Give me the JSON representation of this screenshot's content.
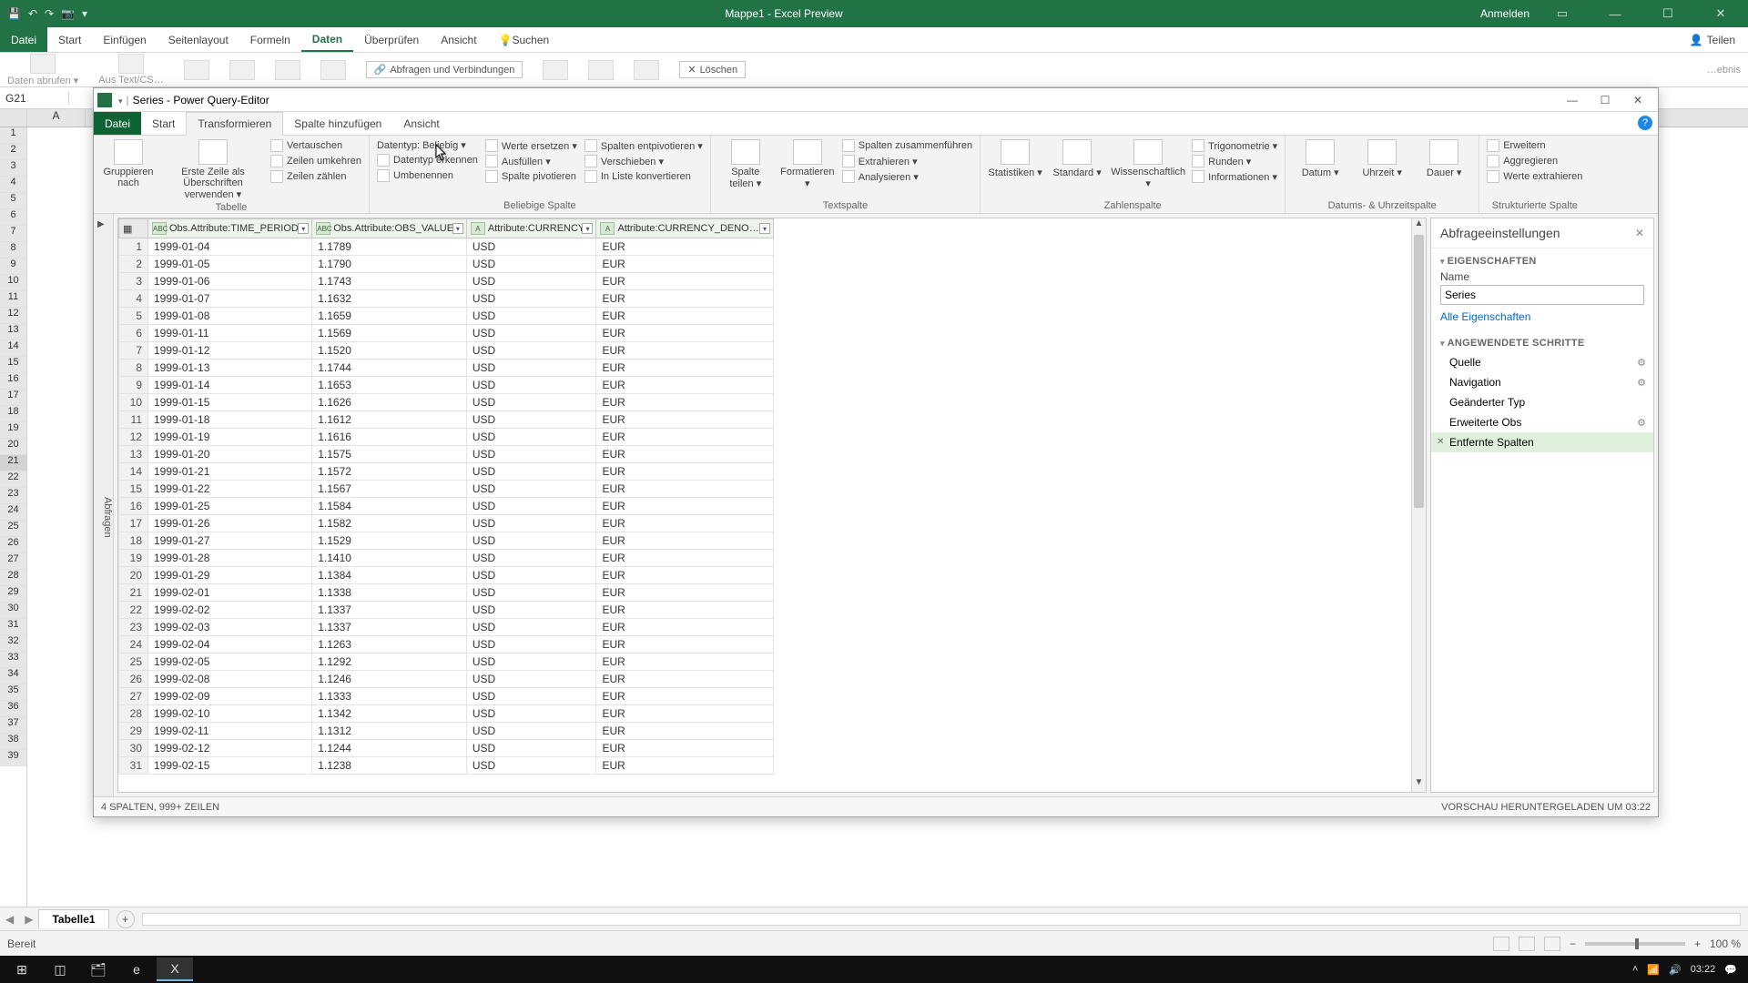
{
  "app": {
    "title": "Mappe1  -  Excel Preview",
    "signin": "Anmelden"
  },
  "excel_tabs": {
    "file": "Datei",
    "start": "Start",
    "insert": "Einfügen",
    "layout": "Seitenlayout",
    "formulas": "Formeln",
    "data": "Daten",
    "review": "Überprüfen",
    "view": "Ansicht",
    "search_ph": "Suchen",
    "share": "Teilen"
  },
  "excel_ribbon": {
    "get": "Daten abrufen ▾",
    "fromtxt": "Aus Text/CS…",
    "conns": "Abfragen und Verbindungen",
    "del": "Löschen",
    "result": "…ebnis"
  },
  "namebox": "G21",
  "col_headers": [
    "A"
  ],
  "row_numbers": [
    1,
    2,
    3,
    4,
    5,
    6,
    7,
    8,
    9,
    10,
    11,
    12,
    13,
    14,
    15,
    16,
    17,
    18,
    19,
    20,
    21,
    22,
    23,
    24,
    25,
    26,
    27,
    28,
    29,
    30,
    31,
    32,
    33,
    34,
    35,
    36,
    37,
    38,
    39
  ],
  "pq": {
    "title": "Series - Power Query-Editor",
    "tabs": {
      "file": "Datei",
      "start": "Start",
      "transform": "Transformieren",
      "addcol": "Spalte hinzufügen",
      "view": "Ansicht"
    },
    "groups": {
      "table": "Tabelle",
      "any": "Beliebige Spalte",
      "text": "Textspalte",
      "num": "Zahlenspalte",
      "dt": "Datums- & Uhrzeitspalte",
      "struct": "Strukturierte Spalte"
    },
    "btns": {
      "groupby": "Gruppieren nach",
      "firstrow": "Erste Zeile als Überschriften verwenden ▾",
      "swap": "Vertauschen",
      "reverse": "Zeilen umkehren",
      "count": "Zeilen zählen",
      "dtype": "Datentyp: Beliebig ▾",
      "detect": "Datentyp erkennen",
      "rename": "Umbenennen",
      "replace": "Werte ersetzen ▾",
      "fill": "Ausfüllen ▾",
      "pivot": "Spalte pivotieren",
      "unpivot": "Spalten entpivotieren ▾",
      "move": "Verschieben ▾",
      "tolist": "In Liste konvertieren",
      "split": "Spalte teilen ▾",
      "format": "Formatieren ▾",
      "merge": "Spalten zusammenführen",
      "extract": "Extrahieren ▾",
      "analyze": "Analysieren ▾",
      "stats": "Statistiken ▾",
      "standard": "Standard ▾",
      "sci": "Wissenschaftlich ▾",
      "trig": "Trigonometrie ▾",
      "round": "Runden ▾",
      "info": "Informationen ▾",
      "date": "Datum ▾",
      "time": "Uhrzeit ▾",
      "dur": "Dauer ▾",
      "expand": "Erweitern",
      "aggregate": "Aggregieren",
      "extractvals": "Werte extrahieren"
    },
    "queries_label": "Abfragen",
    "columns": [
      "Obs.Attribute:TIME_PERIOD",
      "Obs.Attribute:OBS_VALUE",
      "Attribute:CURRENCY",
      "Attribute:CURRENCY_DENO…"
    ],
    "rows": [
      {
        "n": 1,
        "d": "1999-01-04",
        "v": "1.1789",
        "c": "USD",
        "cd": "EUR"
      },
      {
        "n": 2,
        "d": "1999-01-05",
        "v": "1.1790",
        "c": "USD",
        "cd": "EUR"
      },
      {
        "n": 3,
        "d": "1999-01-06",
        "v": "1.1743",
        "c": "USD",
        "cd": "EUR"
      },
      {
        "n": 4,
        "d": "1999-01-07",
        "v": "1.1632",
        "c": "USD",
        "cd": "EUR"
      },
      {
        "n": 5,
        "d": "1999-01-08",
        "v": "1.1659",
        "c": "USD",
        "cd": "EUR"
      },
      {
        "n": 6,
        "d": "1999-01-11",
        "v": "1.1569",
        "c": "USD",
        "cd": "EUR"
      },
      {
        "n": 7,
        "d": "1999-01-12",
        "v": "1.1520",
        "c": "USD",
        "cd": "EUR"
      },
      {
        "n": 8,
        "d": "1999-01-13",
        "v": "1.1744",
        "c": "USD",
        "cd": "EUR"
      },
      {
        "n": 9,
        "d": "1999-01-14",
        "v": "1.1653",
        "c": "USD",
        "cd": "EUR"
      },
      {
        "n": 10,
        "d": "1999-01-15",
        "v": "1.1626",
        "c": "USD",
        "cd": "EUR"
      },
      {
        "n": 11,
        "d": "1999-01-18",
        "v": "1.1612",
        "c": "USD",
        "cd": "EUR"
      },
      {
        "n": 12,
        "d": "1999-01-19",
        "v": "1.1616",
        "c": "USD",
        "cd": "EUR"
      },
      {
        "n": 13,
        "d": "1999-01-20",
        "v": "1.1575",
        "c": "USD",
        "cd": "EUR"
      },
      {
        "n": 14,
        "d": "1999-01-21",
        "v": "1.1572",
        "c": "USD",
        "cd": "EUR"
      },
      {
        "n": 15,
        "d": "1999-01-22",
        "v": "1.1567",
        "c": "USD",
        "cd": "EUR"
      },
      {
        "n": 16,
        "d": "1999-01-25",
        "v": "1.1584",
        "c": "USD",
        "cd": "EUR"
      },
      {
        "n": 17,
        "d": "1999-01-26",
        "v": "1.1582",
        "c": "USD",
        "cd": "EUR"
      },
      {
        "n": 18,
        "d": "1999-01-27",
        "v": "1.1529",
        "c": "USD",
        "cd": "EUR"
      },
      {
        "n": 19,
        "d": "1999-01-28",
        "v": "1.1410",
        "c": "USD",
        "cd": "EUR"
      },
      {
        "n": 20,
        "d": "1999-01-29",
        "v": "1.1384",
        "c": "USD",
        "cd": "EUR"
      },
      {
        "n": 21,
        "d": "1999-02-01",
        "v": "1.1338",
        "c": "USD",
        "cd": "EUR"
      },
      {
        "n": 22,
        "d": "1999-02-02",
        "v": "1.1337",
        "c": "USD",
        "cd": "EUR"
      },
      {
        "n": 23,
        "d": "1999-02-03",
        "v": "1.1337",
        "c": "USD",
        "cd": "EUR"
      },
      {
        "n": 24,
        "d": "1999-02-04",
        "v": "1.1263",
        "c": "USD",
        "cd": "EUR"
      },
      {
        "n": 25,
        "d": "1999-02-05",
        "v": "1.1292",
        "c": "USD",
        "cd": "EUR"
      },
      {
        "n": 26,
        "d": "1999-02-08",
        "v": "1.1246",
        "c": "USD",
        "cd": "EUR"
      },
      {
        "n": 27,
        "d": "1999-02-09",
        "v": "1.1333",
        "c": "USD",
        "cd": "EUR"
      },
      {
        "n": 28,
        "d": "1999-02-10",
        "v": "1.1342",
        "c": "USD",
        "cd": "EUR"
      },
      {
        "n": 29,
        "d": "1999-02-11",
        "v": "1.1312",
        "c": "USD",
        "cd": "EUR"
      },
      {
        "n": 30,
        "d": "1999-02-12",
        "v": "1.1244",
        "c": "USD",
        "cd": "EUR"
      },
      {
        "n": 31,
        "d": "1999-02-15",
        "v": "1.1238",
        "c": "USD",
        "cd": "EUR"
      }
    ],
    "status_left": "4 SPALTEN, 999+ ZEILEN",
    "status_right": "VORSCHAU HERUNTERGELADEN UM 03:22",
    "settings": {
      "title": "Abfrageeinstellungen",
      "props": "EIGENSCHAFTEN",
      "name_label": "Name",
      "name_value": "Series",
      "allprops": "Alle Eigenschaften",
      "steps_title": "ANGEWENDETE SCHRITTE",
      "steps": [
        {
          "label": "Quelle",
          "gear": true
        },
        {
          "label": "Navigation",
          "gear": true
        },
        {
          "label": "Geänderter Typ",
          "gear": false
        },
        {
          "label": "Erweiterte Obs",
          "gear": true
        },
        {
          "label": "Entfernte Spalten",
          "gear": false,
          "sel": true
        }
      ]
    }
  },
  "sheet_tab": "Tabelle1",
  "status": "Bereit",
  "zoom": "100 %",
  "tray_time": "03:22"
}
